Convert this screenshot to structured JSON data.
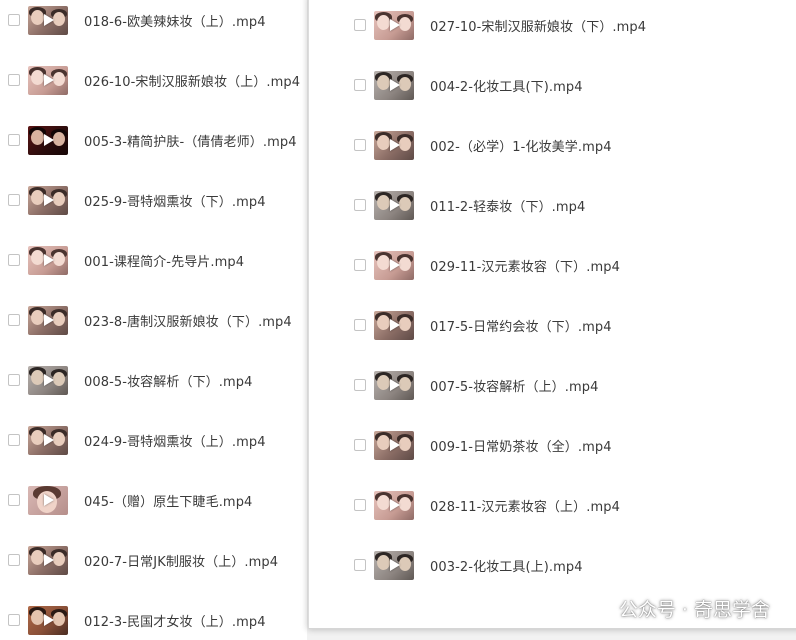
{
  "left_panel": {
    "files": [
      {
        "name": "018-6-欧美辣妹妆（上）.mp4",
        "thumb": "warm"
      },
      {
        "name": "026-10-宋制汉服新娘妆（上）.mp4",
        "thumb": "pink"
      },
      {
        "name": "005-3-精简护肤-（倩倩老师）.mp4",
        "thumb": "dark"
      },
      {
        "name": "025-9-哥特烟熏妆（下）.mp4",
        "thumb": "warm"
      },
      {
        "name": "001-课程简介-先导片.mp4",
        "thumb": "pink"
      },
      {
        "name": "023-8-唐制汉服新娘妆（下）.mp4",
        "thumb": "warm"
      },
      {
        "name": "008-5-妆容解析（下）.mp4",
        "thumb": "grey"
      },
      {
        "name": "024-9-哥特烟熏妆（上）.mp4",
        "thumb": "warm"
      },
      {
        "name": "045-（赠）原生下睫毛.mp4",
        "thumb": "portrait"
      },
      {
        "name": "020-7-日常JK制服妆（上）.mp4",
        "thumb": "warm"
      },
      {
        "name": "012-3-民国才女妆（上）.mp4",
        "thumb": "orange"
      }
    ]
  },
  "right_panel": {
    "files": [
      {
        "name": "027-10-宋制汉服新娘妆（下）.mp4",
        "thumb": "pink"
      },
      {
        "name": "004-2-化妆工具(下).mp4",
        "thumb": "grey"
      },
      {
        "name": "002-（必学）1-化妆美学.mp4",
        "thumb": "warm"
      },
      {
        "name": "011-2-轻泰妆（下）.mp4",
        "thumb": "grey"
      },
      {
        "name": "029-11-汉元素妆容（下）.mp4",
        "thumb": "pink"
      },
      {
        "name": "017-5-日常约会妆（下）.mp4",
        "thumb": "warm"
      },
      {
        "name": "007-5-妆容解析（上）.mp4",
        "thumb": "grey"
      },
      {
        "name": "009-1-日常奶茶妆（全）.mp4",
        "thumb": "warm"
      },
      {
        "name": "028-11-汉元素妆容（上）.mp4",
        "thumb": "pink"
      },
      {
        "name": "003-2-化妆工具(上).mp4",
        "thumb": "grey"
      }
    ]
  },
  "watermark": {
    "text": "公众号 · 奇思学舍",
    "icon": "wechat-icon"
  },
  "colors": {
    "background": "#f2f2f2",
    "panel": "#ffffff",
    "text": "#3a3a3a",
    "checkbox_border": "#c4c4c4"
  }
}
